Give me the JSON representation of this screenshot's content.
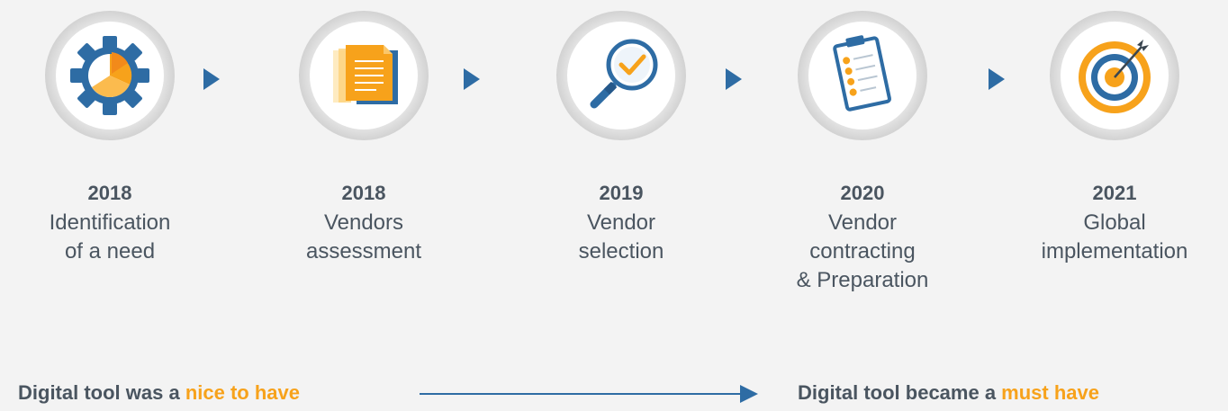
{
  "steps": [
    {
      "year": "2018",
      "label": "Identification\nof a need",
      "icon": "gear-chart-icon"
    },
    {
      "year": "2018",
      "label": "Vendors\nassessment",
      "icon": "document-icon"
    },
    {
      "year": "2019",
      "label": "Vendor\nselection",
      "icon": "magnifier-check-icon"
    },
    {
      "year": "2020",
      "label": "Vendor\ncontracting\n& Preparation",
      "icon": "clipboard-checklist-icon"
    },
    {
      "year": "2021",
      "label": "Global\nimplementation",
      "icon": "target-icon"
    }
  ],
  "bottom": {
    "left_prefix": "Digital tool was a ",
    "left_highlight": "nice to have",
    "right_prefix": "Digital tool became a ",
    "right_highlight": "must have"
  },
  "colors": {
    "accent_orange": "#f7a21b",
    "accent_blue": "#2e6ca4",
    "text": "#4a5560",
    "background": "#f3f3f3"
  }
}
